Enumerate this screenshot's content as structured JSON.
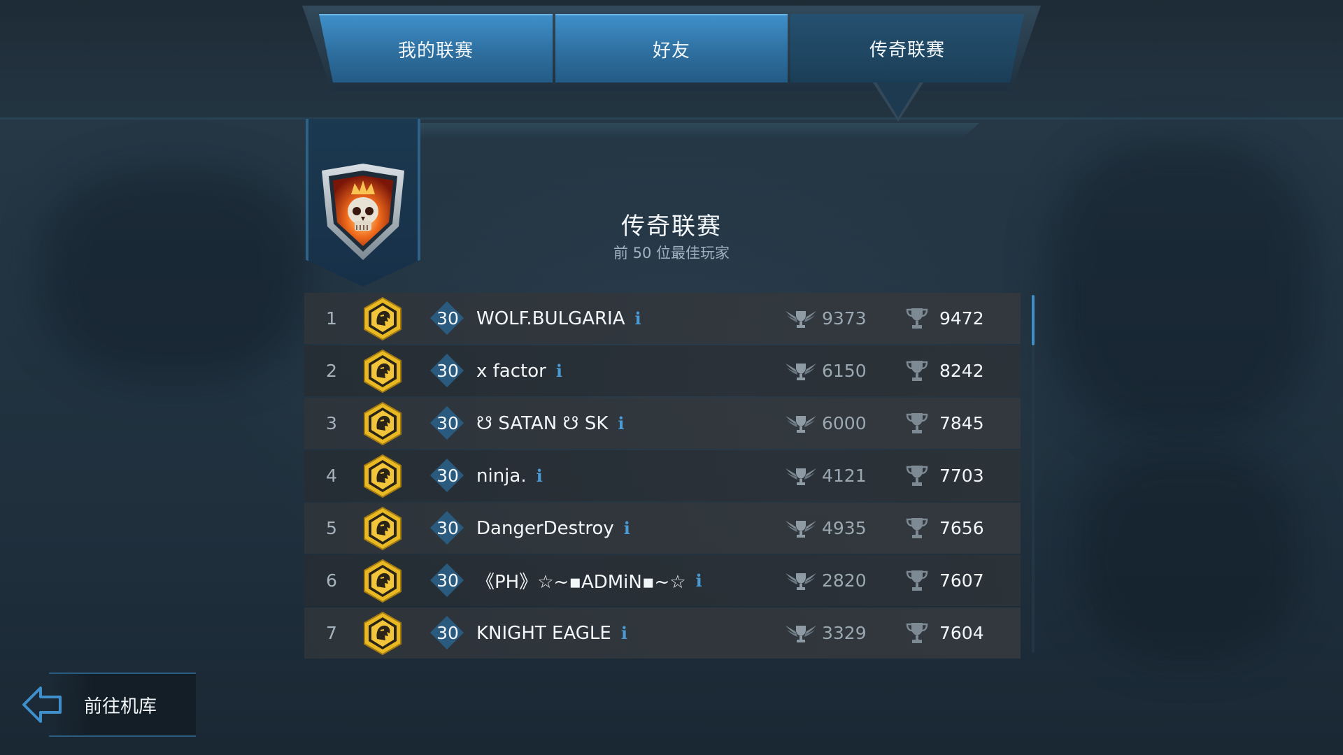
{
  "tabs": [
    {
      "label": "我的联赛"
    },
    {
      "label": "好友"
    },
    {
      "label": "传奇联赛"
    }
  ],
  "league": {
    "title": "传奇联赛",
    "subtitle": "前 50 位最佳玩家",
    "emblem": "flaming-skull-shield-icon"
  },
  "leaderboard": [
    {
      "rank": "1",
      "level": "30",
      "name": "WOLF.BULGARIA",
      "wing_score": "9373",
      "trophies": "9472"
    },
    {
      "rank": "2",
      "level": "30",
      "name": "x factor",
      "wing_score": "6150",
      "trophies": "8242"
    },
    {
      "rank": "3",
      "level": "30",
      "name": "☋ SATAN ☋ SK",
      "wing_score": "6000",
      "trophies": "7845"
    },
    {
      "rank": "4",
      "level": "30",
      "name": "ninja.",
      "wing_score": "4121",
      "trophies": "7703"
    },
    {
      "rank": "5",
      "level": "30",
      "name": "DangerDestroy",
      "wing_score": "4935",
      "trophies": "7656"
    },
    {
      "rank": "6",
      "level": "30",
      "name": "《PH》☆~▪ADMiN▪~☆",
      "wing_score": "2820",
      "trophies": "7607"
    },
    {
      "rank": "7",
      "level": "30",
      "name": "KNIGHT EAGLE",
      "wing_score": "3329",
      "trophies": "7604"
    }
  ],
  "info_glyph": "i",
  "back": {
    "label": "前往机库"
  },
  "colors": {
    "accent": "#3f8fca",
    "gold": "#e8b923",
    "info": "#4a9ad4"
  }
}
